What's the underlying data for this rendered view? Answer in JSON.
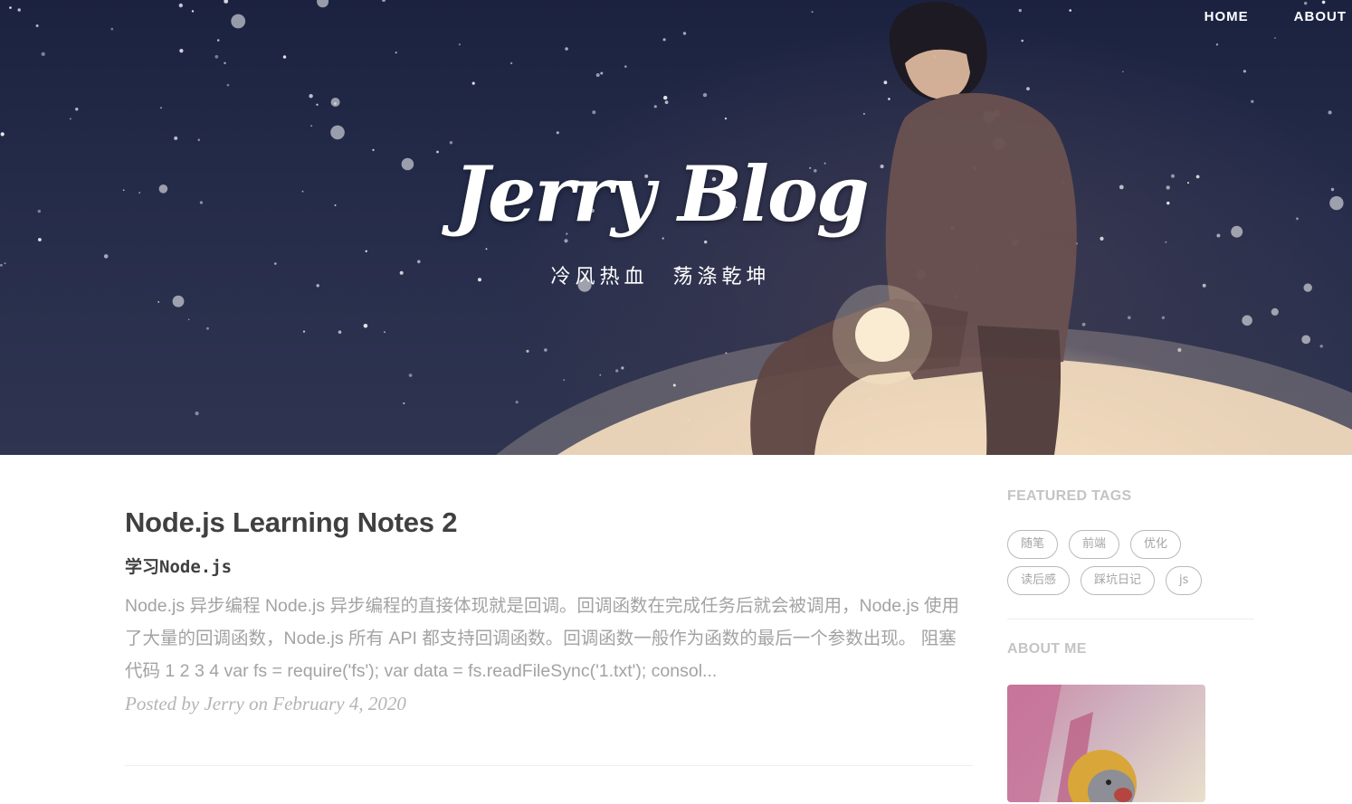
{
  "nav": {
    "home": "HOME",
    "about": "ABOUT"
  },
  "hero": {
    "title": "Jerry Blog",
    "subtitle": "冷风热血　荡涤乾坤"
  },
  "post": {
    "title": "Node.js Learning Notes 2",
    "subtitle": "学习Node.js",
    "excerpt": "Node.js 异步编程 Node.js 异步编程的直接体现就是回调。回调函数在完成任务后就会被调用，Node.js 使用了大量的回调函数，Node.js 所有 API 都支持回调函数。回调函数一般作为函数的最后一个参数出现。 阻塞代码 1 2 3 4 var fs = require('fs'); var data = fs.readFileSync('1.txt'); consol...",
    "meta": "Posted by Jerry on February 4, 2020"
  },
  "sidebar": {
    "featured_tags_heading": "FEATURED TAGS",
    "tags": [
      "随笔",
      "前端",
      "优化",
      "读后感",
      "踩坑日记",
      "js"
    ],
    "about_heading": "ABOUT ME"
  },
  "colors": {
    "title": "#404040",
    "muted": "#a3a3a3",
    "sidebar_heading": "#c4c4c4",
    "hero_sky": "#1b2240"
  },
  "icons": {
    "avatar": "cartoon-mouse-avatar"
  }
}
